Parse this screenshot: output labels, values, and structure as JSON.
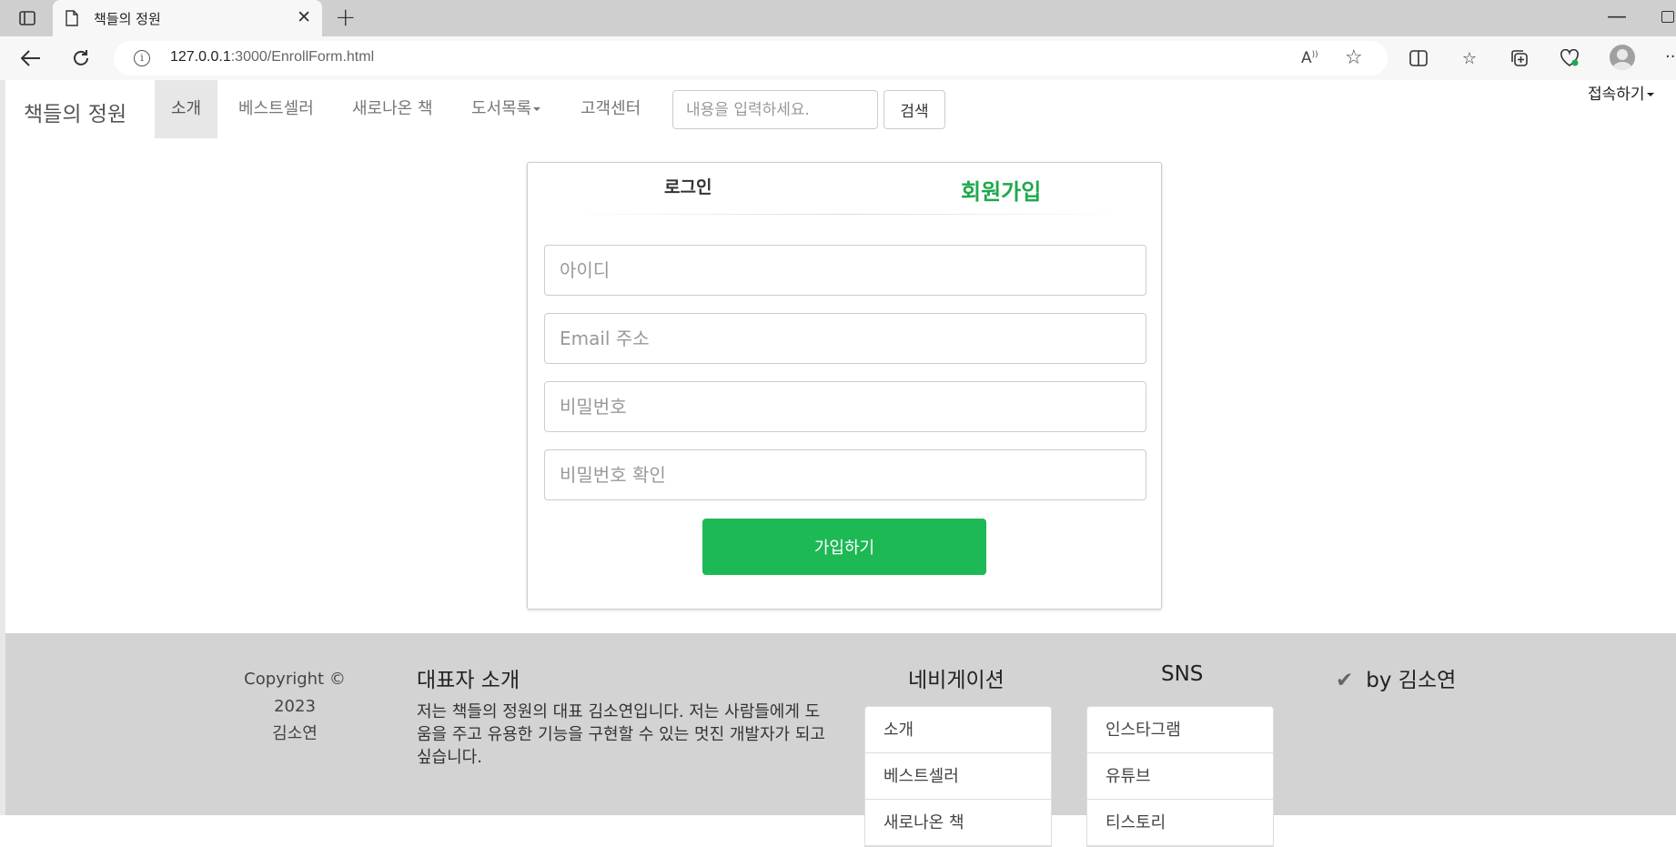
{
  "browser": {
    "tab_title": "책들의 정원",
    "url_host": "127.0.0.1",
    "url_path": ":3000/EnrollForm.html"
  },
  "navbar": {
    "brand": "책들의 정원",
    "items": [
      "소개",
      "베스트셀러",
      "새로나온 책",
      "도서목록",
      "고객센터"
    ],
    "active_item": "소개",
    "search_placeholder": "내용을 입력하세요.",
    "search_button": "검색",
    "connect": "접속하기"
  },
  "form": {
    "tab_login": "로그인",
    "tab_join": "회원가입",
    "fields": {
      "id_placeholder": "아이디",
      "email_placeholder": "Email 주소",
      "password_placeholder": "비밀번호",
      "password_confirm_placeholder": "비밀번호 확인"
    },
    "submit": "가입하기",
    "accent_color": "#1db954"
  },
  "footer": {
    "copyright": "Copyright © 2023",
    "author": "김소연",
    "intro_title": "대표자 소개",
    "intro_text": "저는 책들의 정원의 대표 김소연입니다. 저는 사람들에게 도움을 주고 유용한 기능을 구현할 수 있는 멋진 개발자가 되고 싶습니다.",
    "nav_title": "네비게이션",
    "nav_items": [
      "소개",
      "베스트셀러",
      "새로나온 책"
    ],
    "sns_title": "SNS",
    "sns_items": [
      "인스타그램",
      "유튜브",
      "티스토리"
    ],
    "by_text": "by 김소연"
  }
}
